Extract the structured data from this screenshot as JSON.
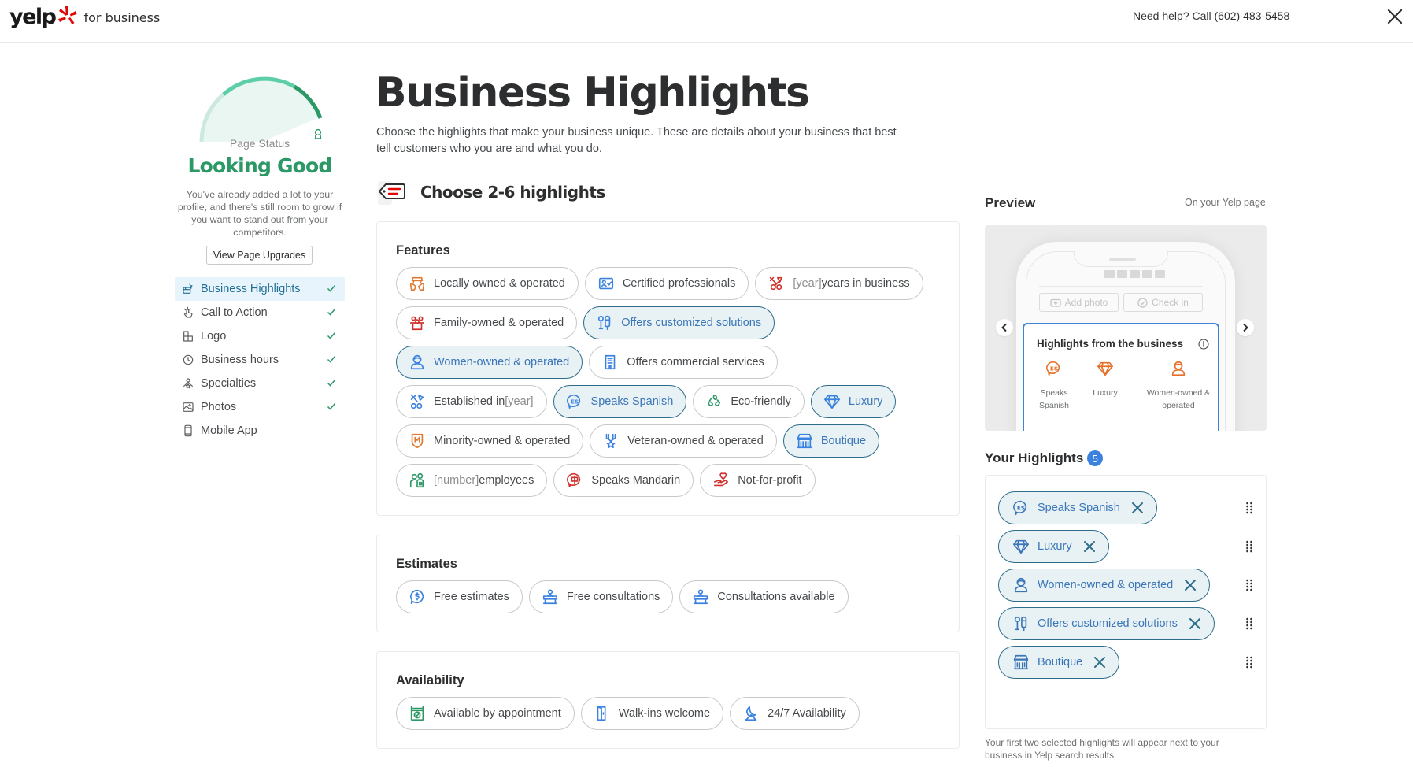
{
  "header": {
    "logo_word": "yelp",
    "logo_sub": "for business",
    "help_prefix": "Need help? Call",
    "help_phone": "(602) 483-5458",
    "close_icon": "close-icon"
  },
  "sidebar": {
    "page_status_label": "Page Status",
    "status_value": "Looking Good",
    "status_description": "You've already added a lot to your profile, and there's still room to grow if you want to stand out from your competitors.",
    "upgrades_button": "View Page Upgrades",
    "gauge_progress": 0.85,
    "nav": [
      {
        "label": "Business Highlights",
        "icon": "highlights-icon",
        "complete": true,
        "active": true
      },
      {
        "label": "Call to Action",
        "icon": "tap-icon",
        "complete": true,
        "active": false
      },
      {
        "label": "Logo",
        "icon": "logo-icon",
        "complete": true,
        "active": false
      },
      {
        "label": "Business hours",
        "icon": "clock-icon",
        "complete": true,
        "active": false
      },
      {
        "label": "Specialties",
        "icon": "specialties-icon",
        "complete": true,
        "active": false
      },
      {
        "label": "Photos",
        "icon": "photo-icon",
        "complete": true,
        "active": false
      },
      {
        "label": "Mobile App",
        "icon": "mobile-icon",
        "complete": false,
        "active": false
      }
    ]
  },
  "main": {
    "title": "Business Highlights",
    "description": "Choose the highlights that make your business unique. These are details about your business that best tell customers who you are and what you do.",
    "choose_label": "Choose 2-6 highlights",
    "sections": [
      {
        "title": "Features",
        "rows": [
          [
            {
              "label": "Locally owned & operated",
              "icon": "local-icon",
              "color": "#e07a2f",
              "selected": false
            },
            {
              "label": "Certified professionals",
              "icon": "certified-icon",
              "color": "#3b82e0",
              "selected": false
            },
            {
              "placeholder": "[year]",
              "label": " years in business",
              "icon": "years-icon",
              "color": "#d0312d",
              "selected": false
            }
          ],
          [
            {
              "label": "Family-owned & operated",
              "icon": "family-icon",
              "color": "#d0312d",
              "selected": false
            },
            {
              "label": "Offers customized solutions",
              "icon": "customized-icon",
              "color": "#3b82e0",
              "selected": true
            }
          ],
          [
            {
              "label": "Women-owned & operated",
              "icon": "women-icon",
              "color": "#3b82e0",
              "selected": true
            },
            {
              "label": "Offers commercial services",
              "icon": "building-icon",
              "color": "#3b82e0",
              "selected": false
            }
          ],
          [
            {
              "label": "Established in ",
              "placeholder_after": "[year]",
              "icon": "established-icon",
              "color": "#3b82e0",
              "selected": false
            },
            {
              "label": "Speaks Spanish",
              "icon": "spanish-icon",
              "color": "#3b82e0",
              "selected": true
            },
            {
              "label": "Eco-friendly",
              "icon": "eco-icon",
              "color": "#2b9866",
              "selected": false
            },
            {
              "label": "Luxury",
              "icon": "diamond-icon",
              "color": "#3b82e0",
              "selected": true
            }
          ],
          [
            {
              "label": "Minority-owned & operated",
              "icon": "minority-icon",
              "color": "#e07a2f",
              "selected": false
            },
            {
              "label": "Veteran-owned & operated",
              "icon": "veteran-icon",
              "color": "#3b82e0",
              "selected": false
            },
            {
              "label": "Boutique",
              "icon": "boutique-icon",
              "color": "#3b82e0",
              "selected": true
            }
          ],
          [
            {
              "placeholder": "[number]",
              "label": " employees",
              "icon": "employees-icon",
              "color": "#2b9866",
              "selected": false
            },
            {
              "label": "Speaks Mandarin",
              "icon": "mandarin-icon",
              "color": "#d0312d",
              "selected": false
            },
            {
              "label": "Not-for-profit",
              "icon": "nonprofit-icon",
              "color": "#d0312d",
              "selected": false
            }
          ]
        ]
      },
      {
        "title": "Estimates",
        "rows": [
          [
            {
              "label": "Free estimates",
              "icon": "dollar-bubble-icon",
              "color": "#3b82e0",
              "selected": false
            },
            {
              "label": "Free consultations",
              "icon": "consult-icon",
              "color": "#3b82e0",
              "selected": false
            },
            {
              "label": "Consultations available",
              "icon": "consult-icon",
              "color": "#3b82e0",
              "selected": false
            }
          ]
        ]
      },
      {
        "title": "Availability",
        "rows": [
          [
            {
              "label": "Available by appointment",
              "icon": "calendar-check-icon",
              "color": "#2b9866",
              "selected": false
            },
            {
              "label": "Walk-ins welcome",
              "icon": "door-icon",
              "color": "#3b82e0",
              "selected": false
            },
            {
              "label": "24/7 Availability",
              "icon": "moon-icon",
              "color": "#3b82e0",
              "selected": false
            }
          ]
        ]
      }
    ]
  },
  "preview": {
    "title": "Preview",
    "subtitle": "On your Yelp page",
    "add_photo": "Add photo",
    "check_in": "Check in",
    "card_title": "Highlights from the business",
    "items": [
      {
        "label": "Speaks Spanish",
        "icon": "spanish-icon"
      },
      {
        "label": "Luxury",
        "icon": "diamond-icon"
      },
      {
        "label": "Women-owned & operated",
        "icon": "women-icon"
      }
    ],
    "accent": "#e5702a"
  },
  "your_highlights": {
    "title": "Your Highlights",
    "count": "5",
    "items": [
      {
        "label": "Speaks Spanish",
        "icon": "spanish-icon"
      },
      {
        "label": "Luxury",
        "icon": "diamond-icon"
      },
      {
        "label": "Women-owned & operated",
        "icon": "women-icon"
      },
      {
        "label": "Offers customized solutions",
        "icon": "customized-icon"
      },
      {
        "label": "Boutique",
        "icon": "boutique-icon"
      }
    ],
    "note": "Your first two selected highlights will appear next to your business in Yelp search results."
  },
  "colors": {
    "brand_red": "#e00707",
    "status_green": "#2b9866",
    "selected_border": "#2e6d8a",
    "selected_text": "#3a76b8",
    "badge_blue": "#3b82e0"
  }
}
